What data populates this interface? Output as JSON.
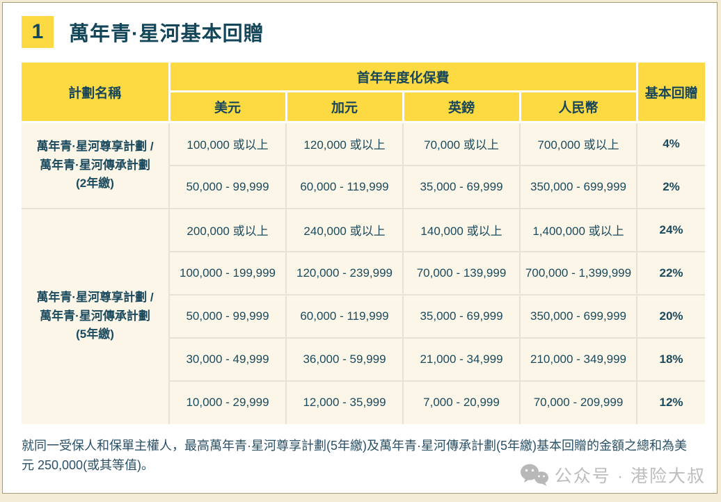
{
  "header": {
    "number": "1",
    "title": "萬年青·星河基本回贈"
  },
  "table": {
    "col_plan": "計劃名稱",
    "col_premium": "首年年度化保費",
    "col_rebate": "基本回贈",
    "currencies": [
      "美元",
      "加元",
      "英鎊",
      "人民幣"
    ],
    "groups": [
      {
        "name_line1": "萬年青·星河尊享計劃 /",
        "name_line2": "萬年青·星河傳承計劃",
        "name_line3": "(2年繳)"
      },
      {
        "name_line1": "萬年青·星河尊享計劃 /",
        "name_line2": "萬年青·星河傳承計劃",
        "name_line3": "(5年繳)"
      }
    ],
    "rows": [
      {
        "usd": "100,000 或以上",
        "cad": "120,000 或以上",
        "gbp": "70,000 或以上",
        "rmb": "700,000 或以上",
        "rebate": "4%"
      },
      {
        "usd": "50,000 - 99,999",
        "cad": "60,000 - 119,999",
        "gbp": "35,000 - 69,999",
        "rmb": "350,000 - 699,999",
        "rebate": "2%"
      },
      {
        "usd": "200,000 或以上",
        "cad": "240,000 或以上",
        "gbp": "140,000 或以上",
        "rmb": "1,400,000 或以上",
        "rebate": "24%"
      },
      {
        "usd": "100,000 - 199,999",
        "cad": "120,000 - 239,999",
        "gbp": "70,000 - 139,999",
        "rmb": "700,000 - 1,399,999",
        "rebate": "22%"
      },
      {
        "usd": "50,000 - 99,999",
        "cad": "60,000 - 119,999",
        "gbp": "35,000 - 69,999",
        "rmb": "350,000 - 699,999",
        "rebate": "20%"
      },
      {
        "usd": "30,000 - 49,999",
        "cad": "36,000 - 59,999",
        "gbp": "21,000 - 34,999",
        "rmb": "210,000 - 349,999",
        "rebate": "18%"
      },
      {
        "usd": "10,000 - 29,999",
        "cad": "12,000 - 35,999",
        "gbp": "7,000 - 20,999",
        "rmb": "70,000 - 209,999",
        "rebate": "12%"
      }
    ]
  },
  "footnote": "就同一受保人和保單主權人，最高萬年青·星河尊享計劃(5年繳)及萬年青·星河傳承計劃(5年繳)基本回贈的金額之總和為美元 250,000(或其等值)。",
  "watermark": {
    "text": "公众号 · 港险大叔"
  },
  "colors": {
    "accent_yellow": "#fdd942",
    "teal_text": "#14465a",
    "cell_cream": "#fbf6e7",
    "plan_cell_cream": "#fcf7de",
    "card_border": "#a89d72",
    "page_bg": "#f4ecd6",
    "watermark_gray": "#bdbdbd"
  }
}
